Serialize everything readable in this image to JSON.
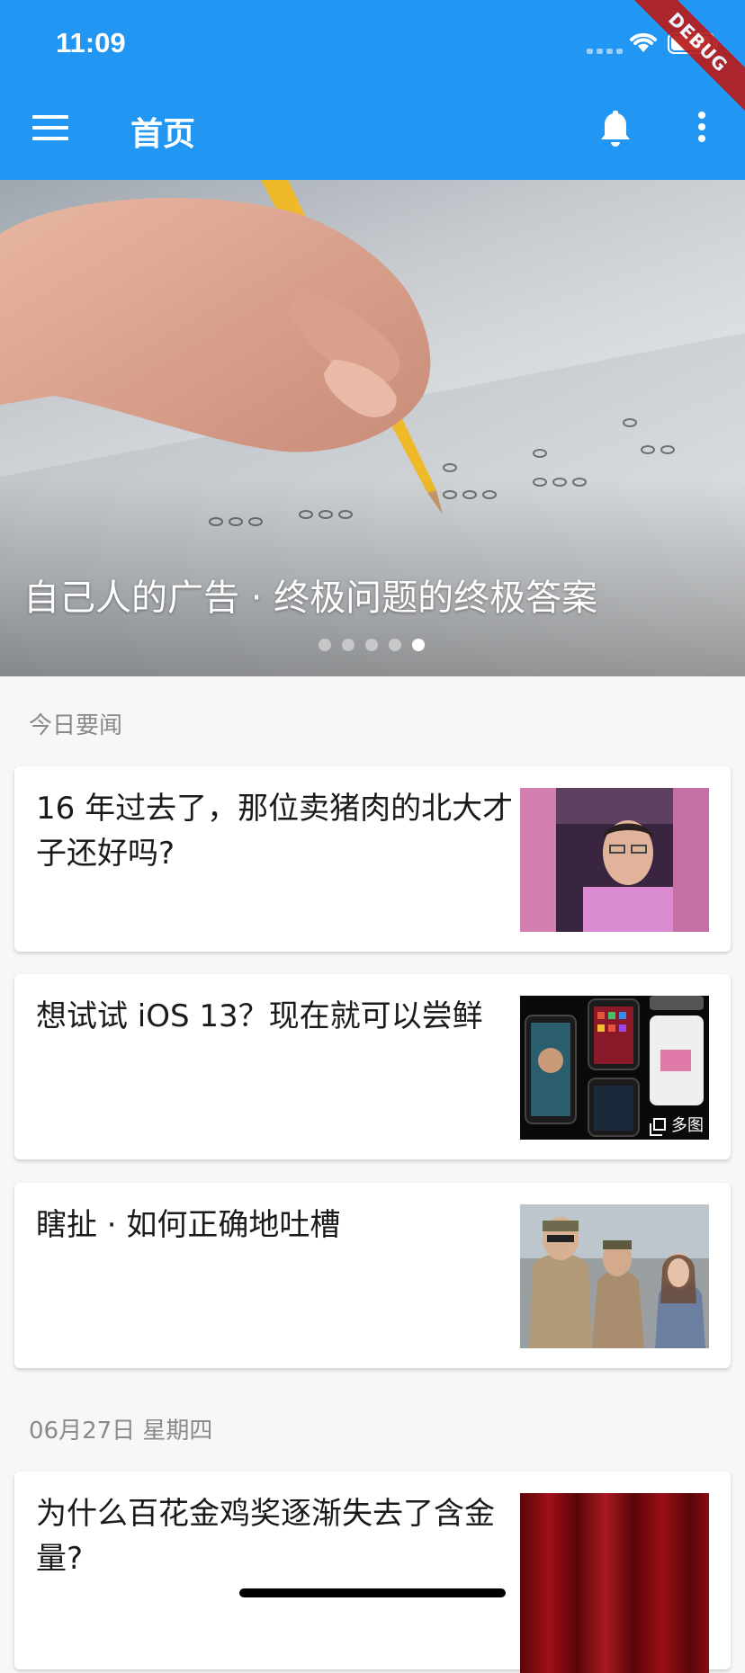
{
  "status_bar": {
    "time": "11:09"
  },
  "debug_banner": "DEBUG",
  "app_bar": {
    "title": "首页"
  },
  "banner": {
    "caption": "自己人的广告 · 终极问题的终极答案",
    "page_count": 5,
    "active_index": 4
  },
  "sections": [
    {
      "header": "今日要闻",
      "stories": [
        {
          "title": "16 年过去了，那位卖猪肉的北大才子还好吗?",
          "thumb": "man-in-pink-shirt"
        },
        {
          "title": "想试试 iOS 13？现在就可以尝鲜",
          "thumb": "phone-screens",
          "badge": "多图"
        },
        {
          "title": "瞎扯 · 如何正确地吐槽",
          "thumb": "soldiers-drama-still"
        }
      ]
    },
    {
      "header": "06月27日 星期四",
      "stories": [
        {
          "title": "为什么百花金鸡奖逐渐失去了含金量?",
          "thumb": "red-curtain"
        }
      ]
    }
  ],
  "colors": {
    "primary": "#2196f3",
    "background": "#f7f7f7",
    "debug": "#b71c1c"
  }
}
